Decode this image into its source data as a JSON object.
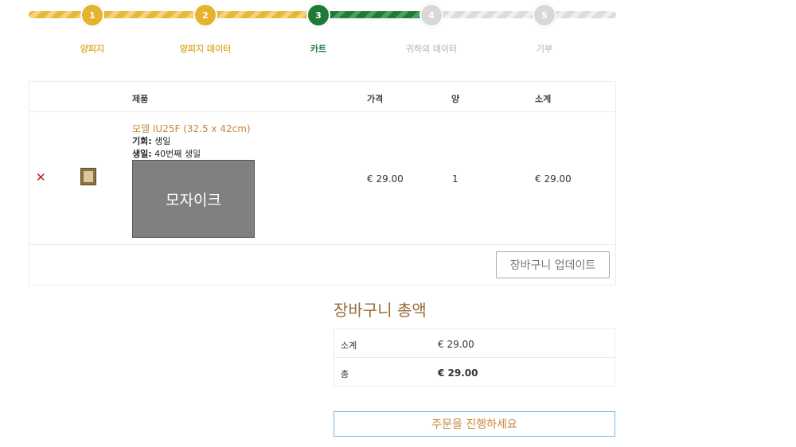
{
  "steps": [
    {
      "number": "1",
      "label": "양피지"
    },
    {
      "number": "2",
      "label": "양피지 데이터"
    },
    {
      "number": "3",
      "label": "카트"
    },
    {
      "number": "4",
      "label": "귀하의 데이터"
    },
    {
      "number": "5",
      "label": "기부"
    }
  ],
  "cart": {
    "headers": {
      "product": "제품",
      "price": "가격",
      "quantity": "양",
      "subtotal": "소계"
    },
    "item": {
      "remove_symbol": "✕",
      "name": "모델 IU25F (32.5 x 42cm)",
      "occasion_label": "기회:",
      "occasion_value": "생일",
      "birthday_label": "생일:",
      "birthday_value": "40번째 생일",
      "preview_text": "모자이크",
      "price": "€ 29.00",
      "quantity": "1",
      "subtotal": "€ 29.00"
    },
    "update_button": "장바구니 업데이트"
  },
  "totals": {
    "title": "장바구니 총액",
    "subtotal_label": "소계",
    "subtotal_value": "€ 29.00",
    "total_label": "총",
    "total_value": "€ 29.00"
  },
  "checkout_button": "주문을 진행하세요",
  "colors": {
    "gold": "#e4b330",
    "green": "#1f7a37",
    "inactive": "#d8d8d8",
    "link": "#c8853a",
    "remove": "#c0141b"
  }
}
